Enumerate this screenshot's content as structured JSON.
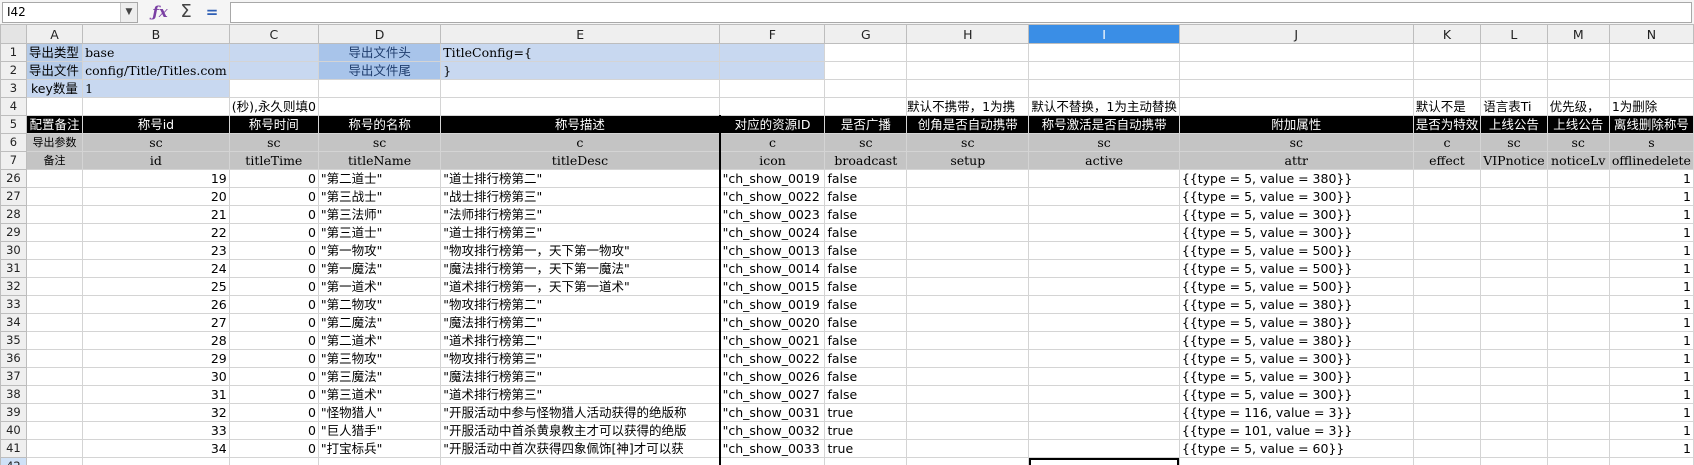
{
  "formula_bar": {
    "cell_ref": "I42",
    "formula": ""
  },
  "columns": [
    "A",
    "B",
    "C",
    "D",
    "E",
    "F",
    "G",
    "H",
    "I",
    "J",
    "K",
    "L",
    "M",
    "N"
  ],
  "config_rows": {
    "r1": {
      "row": "1",
      "a": "导出类型",
      "b": "base",
      "d": "导出文件头",
      "e": "TitleConfig={"
    },
    "r2": {
      "row": "2",
      "a": "导出文件",
      "b": "config/Title/Titles.com",
      "d": "导出文件尾",
      "e": "}"
    },
    "r3": {
      "row": "3",
      "a": "key数量",
      "b": "1"
    },
    "r4": {
      "row": "4",
      "c": "(秒),永久则填0",
      "h": "默认不携带，1为携",
      "i": "默认不替换，1为主动替换",
      "k": "默认不是",
      "l": "语言表Ti",
      "m": "优先级，",
      "n": "1为删除"
    }
  },
  "header_row5": {
    "row": "5",
    "cells": [
      "配置备注",
      "称号id",
      "称号时间",
      "称号的名称",
      "称号描述",
      "对应的资源ID",
      "是否广播",
      "创角是否自动携带",
      "称号激活是否自动携带",
      "附加属性",
      "是否为特效",
      "上线公告",
      "上线公告",
      "离线删除称号"
    ]
  },
  "header_row6": {
    "row": "6",
    "cells": [
      "导出参数",
      "sc",
      "sc",
      "sc",
      "c",
      "c",
      "sc",
      "sc",
      "sc",
      "sc",
      "c",
      "sc",
      "sc",
      "s"
    ]
  },
  "header_row7": {
    "row": "7",
    "cells": [
      "备注",
      "id",
      "titleTime",
      "titleName",
      "titleDesc",
      "icon",
      "broadcast",
      "setup",
      "active",
      "attr",
      "effect",
      "VIPnotice",
      "noticeLv",
      "offlinedelete"
    ]
  },
  "data_rows": [
    {
      "row": "26",
      "id": "19",
      "time": "0",
      "name": "\"第二道士\"",
      "desc": "\"道士排行榜第二\"",
      "icon": "\"ch_show_0019",
      "bc": "false",
      "attr": "{{type = 5, value = 380}}",
      "del": "1"
    },
    {
      "row": "27",
      "id": "20",
      "time": "0",
      "name": "\"第三战士\"",
      "desc": "\"战士排行榜第三\"",
      "icon": "\"ch_show_0022",
      "bc": "false",
      "attr": "{{type = 5, value = 300}}",
      "del": "1"
    },
    {
      "row": "28",
      "id": "21",
      "time": "0",
      "name": "\"第三法师\"",
      "desc": "\"法师排行榜第三\"",
      "icon": "\"ch_show_0023",
      "bc": "false",
      "attr": "{{type = 5, value = 300}}",
      "del": "1"
    },
    {
      "row": "29",
      "id": "22",
      "time": "0",
      "name": "\"第三道士\"",
      "desc": "\"道士排行榜第三\"",
      "icon": "\"ch_show_0024",
      "bc": "false",
      "attr": "{{type = 5, value = 300}}",
      "del": "1"
    },
    {
      "row": "30",
      "id": "23",
      "time": "0",
      "name": "\"第一物攻\"",
      "desc": "\"物攻排行榜第一，天下第一物攻\"",
      "icon": "\"ch_show_0013",
      "bc": "false",
      "attr": "{{type = 5, value = 500}}",
      "del": "1"
    },
    {
      "row": "31",
      "id": "24",
      "time": "0",
      "name": "\"第一魔法\"",
      "desc": "\"魔法排行榜第一，天下第一魔法\"",
      "icon": "\"ch_show_0014",
      "bc": "false",
      "attr": "{{type = 5, value = 500}}",
      "del": "1"
    },
    {
      "row": "32",
      "id": "25",
      "time": "0",
      "name": "\"第一道术\"",
      "desc": "\"道术排行榜第一，天下第一道术\"",
      "icon": "\"ch_show_0015",
      "bc": "false",
      "attr": "{{type = 5, value = 500}}",
      "del": "1"
    },
    {
      "row": "33",
      "id": "26",
      "time": "0",
      "name": "\"第二物攻\"",
      "desc": "\"物攻排行榜第二\"",
      "icon": "\"ch_show_0019",
      "bc": "false",
      "attr": "{{type = 5, value = 380}}",
      "del": "1"
    },
    {
      "row": "34",
      "id": "27",
      "time": "0",
      "name": "\"第二魔法\"",
      "desc": "\"魔法排行榜第二\"",
      "icon": "\"ch_show_0020",
      "bc": "false",
      "attr": "{{type = 5, value = 380}}",
      "del": "1"
    },
    {
      "row": "35",
      "id": "28",
      "time": "0",
      "name": "\"第二道术\"",
      "desc": "\"道术排行榜第二\"",
      "icon": "\"ch_show_0021",
      "bc": "false",
      "attr": "{{type = 5, value = 380}}",
      "del": "1"
    },
    {
      "row": "36",
      "id": "29",
      "time": "0",
      "name": "\"第三物攻\"",
      "desc": "\"物攻排行榜第三\"",
      "icon": "\"ch_show_0022",
      "bc": "false",
      "attr": "{{type = 5, value = 300}}",
      "del": "1"
    },
    {
      "row": "37",
      "id": "30",
      "time": "0",
      "name": "\"第三魔法\"",
      "desc": "\"魔法排行榜第三\"",
      "icon": "\"ch_show_0026",
      "bc": "false",
      "attr": "{{type = 5, value = 300}}",
      "del": "1"
    },
    {
      "row": "38",
      "id": "31",
      "time": "0",
      "name": "\"第三道术\"",
      "desc": "\"道术排行榜第三\"",
      "icon": "\"ch_show_0027",
      "bc": "false",
      "attr": "{{type = 5, value = 300}}",
      "del": "1"
    },
    {
      "row": "39",
      "id": "32",
      "time": "0",
      "name": "\"怪物猎人\"",
      "desc": "\"开服活动中参与怪物猎人活动获得的绝版称",
      "icon": "\"ch_show_0031",
      "bc": "true",
      "attr": "{{type = 116, value = 3}}",
      "del": "1"
    },
    {
      "row": "40",
      "id": "33",
      "time": "0",
      "name": "\"巨人猎手\"",
      "desc": "\"开服活动中首杀黄泉教主才可以获得的绝版",
      "icon": "\"ch_show_0032",
      "bc": "true",
      "attr": "{{type = 101, value = 3}}",
      "del": "1"
    },
    {
      "row": "41",
      "id": "34",
      "time": "0",
      "name": "\"打宝标兵\"",
      "desc": "\"开服活动中首次获得四象佩饰[神]才可以获",
      "icon": "\"ch_show_0033",
      "bc": "true",
      "attr": "{{type = 5, value = 60}}",
      "del": "1"
    }
  ],
  "last_row": {
    "row": "42"
  }
}
